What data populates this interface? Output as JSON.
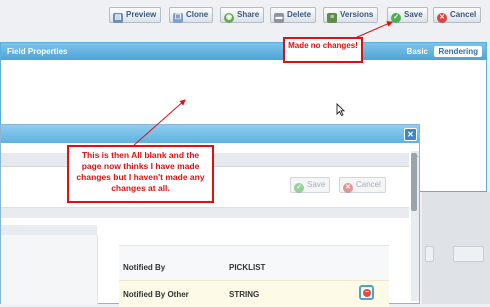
{
  "toolbar": {
    "buttons": [
      {
        "label": "Preview",
        "icon": "preview-icon"
      },
      {
        "label": "Clone",
        "icon": "clone-icon"
      },
      {
        "label": "Share",
        "icon": "share-icon"
      },
      {
        "label": "Delete",
        "icon": "delete-icon"
      },
      {
        "label": "Versions",
        "icon": "versions-icon"
      },
      {
        "label": "Save",
        "icon": "save-icon"
      },
      {
        "label": "Cancel",
        "icon": "cancel-icon"
      }
    ]
  },
  "field_properties": {
    "title": "Field Properties",
    "tabs": [
      {
        "label": "Basic",
        "active": false
      },
      {
        "label": "Rendering",
        "active": true
      }
    ]
  },
  "dialog": {
    "buttons": {
      "save": "Save",
      "cancel": "Cancel"
    },
    "rows": [
      {
        "name": "Notified By",
        "type": "PICKLIST"
      },
      {
        "name": "Notified By Other",
        "type": "STRING"
      }
    ]
  },
  "annotations": {
    "top": "Made no changes!",
    "big": "This is then All blank and the page now thinks I have made changes but I haven't made any changes at all."
  },
  "colors": {
    "panel_header": "#5aaedc",
    "callout_border": "#e01010",
    "accent_text": "#3e5a80"
  }
}
